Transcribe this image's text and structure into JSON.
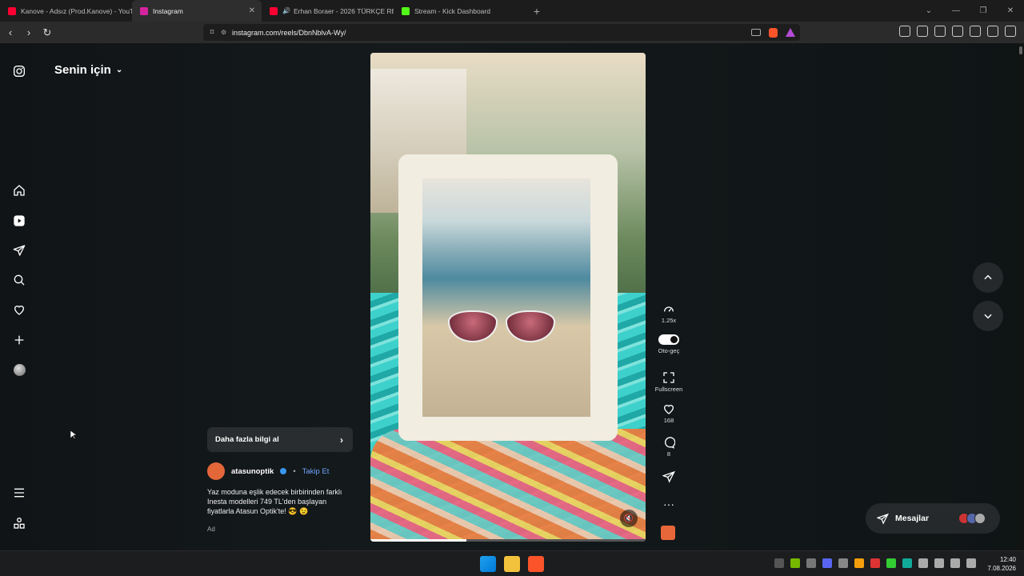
{
  "browser": {
    "tabs": [
      {
        "label": "Kanove - Adsız (Prod.Kanove) - YouTu",
        "favicon_color": "#ff0033",
        "active": false
      },
      {
        "label": "Instagram",
        "favicon_color": "#d6249f",
        "active": true
      },
      {
        "label": "Erhan Boraer - 2026 TÜRKÇE REM",
        "favicon_color": "#ff0033",
        "active": false
      },
      {
        "label": "Stream - Kick Dashboard",
        "favicon_color": "#53fc18",
        "active": false
      }
    ],
    "url": "instagram.com/reels/DbnNblvA-Wy/"
  },
  "sidebar": {
    "items": [
      {
        "name": "instagram-logo-icon"
      },
      {
        "name": "home-icon"
      },
      {
        "name": "reels-icon"
      },
      {
        "name": "direct-icon"
      },
      {
        "name": "search-icon"
      },
      {
        "name": "heart-icon"
      },
      {
        "name": "create-icon"
      },
      {
        "name": "profile-avatar"
      },
      {
        "name": "menu-icon"
      },
      {
        "name": "more-icon"
      }
    ]
  },
  "feed": {
    "title": "Senin için"
  },
  "reel": {
    "progress": 0.35,
    "actions": {
      "speed": "1.25x",
      "autoplay": "Oto-geç",
      "fullscreen": "Fullscreen",
      "likes": "168",
      "comments": "8"
    },
    "more_info": "Daha fazla bilgi al",
    "author": "atasunoptik",
    "follow": "Takip Et",
    "separator": "•",
    "caption": "Yaz moduna eşlik edecek birbirinden farklı Inesta modelleri 749 TL'den başlayan fiyatlarla Atasun Optik'te! 😎 😉",
    "ad_label": "Ad"
  },
  "messages": {
    "label": "Mesajlar"
  },
  "taskbar": {
    "time": "12:40",
    "date": "7.08.2026"
  },
  "colors": {
    "accent": "#3897f0",
    "follow": "#6ea3ff",
    "brand": "#e4673a"
  }
}
